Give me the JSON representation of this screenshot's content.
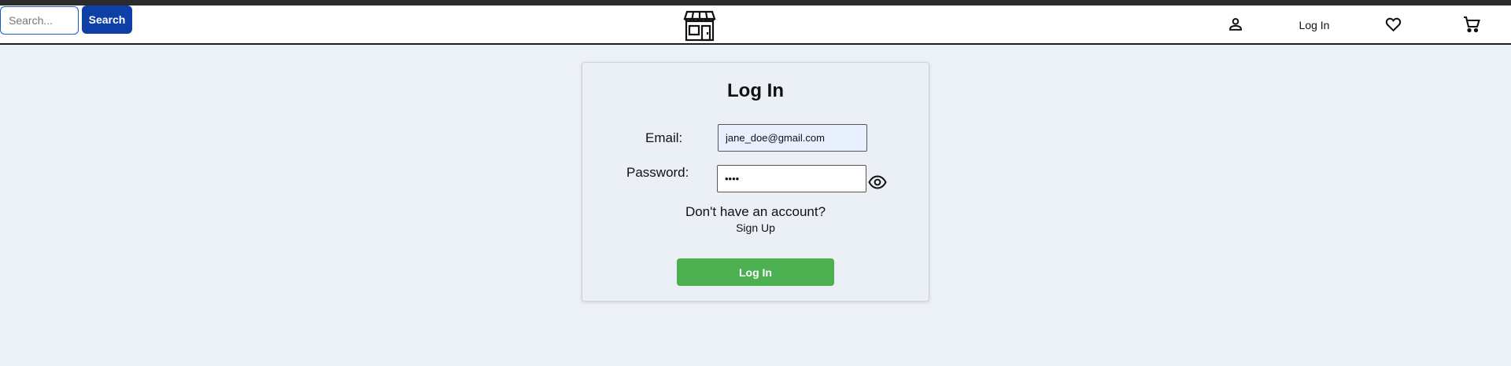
{
  "header": {
    "search": {
      "placeholder": "Search...",
      "value": ""
    },
    "search_button_label": "Search",
    "logo_icon": "storefront-icon",
    "user_icon": "person-icon",
    "login_link_label": "Log In",
    "favorites_icon": "heart-icon",
    "cart_icon": "cart-icon"
  },
  "login_form": {
    "title": "Log In",
    "email_label": "Email:",
    "email_value": "jane_doe@gmail.com",
    "password_label": "Password:",
    "password_value": "••••",
    "password_toggle_icon": "eye-icon",
    "no_account_text": "Don't have an account?",
    "signup_link_label": "Sign Up",
    "submit_label": "Log In"
  },
  "colors": {
    "page_background": "#ecf1f7",
    "search_button": "#0d3fa6",
    "search_border": "#1a57c9",
    "submit_button": "#4caf50",
    "email_autofill": "#e8f0fe"
  }
}
